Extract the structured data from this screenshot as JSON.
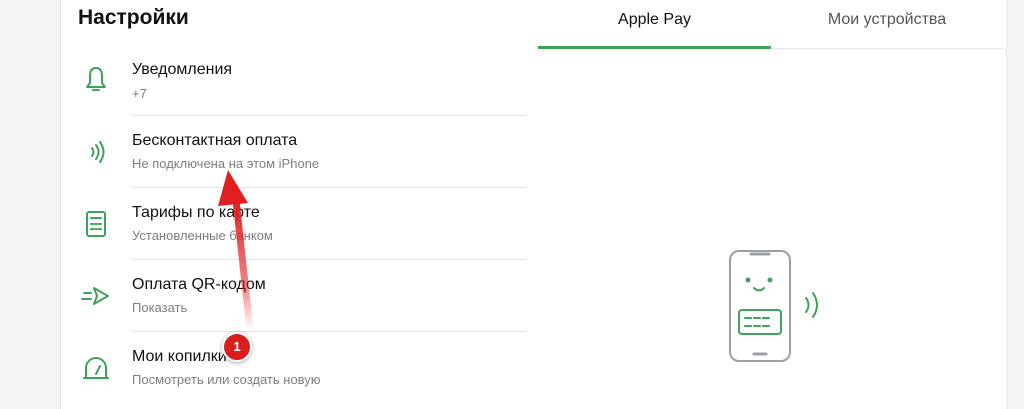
{
  "header": {
    "title": "Настройки"
  },
  "settings": {
    "items": [
      {
        "title": "Уведомления",
        "subtitle": "+7",
        "icon": "bell-icon"
      },
      {
        "title": "Бесконтактная оплата",
        "subtitle": "Не подключена на этом iPhone",
        "icon": "contactless-icon"
      },
      {
        "title": "Тарифы по карте",
        "subtitle": "Установленные банком",
        "icon": "calculator-icon"
      },
      {
        "title": "Оплата QR-кодом",
        "subtitle": "Показать",
        "icon": "send-arrow-icon"
      },
      {
        "title": "Мои копилки",
        "subtitle": "Посмотреть или создать новую",
        "icon": "piggy-gauge-icon"
      }
    ]
  },
  "tabs": {
    "active": "Apple Pay",
    "inactive": "Мои устройства"
  },
  "annotation": {
    "badge": "1"
  },
  "colors": {
    "accent": "#3da35a",
    "badge": "#d91e1e",
    "arrow": "#e02020"
  }
}
